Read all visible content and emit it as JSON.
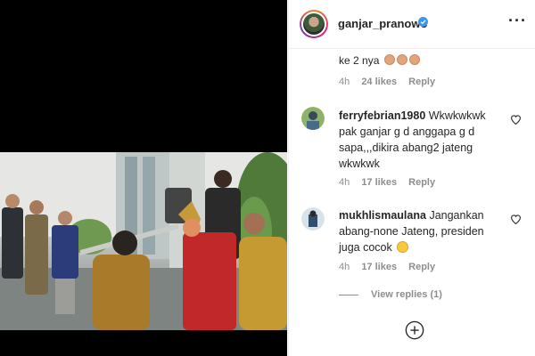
{
  "post": {
    "username": "ganjar_pranowo",
    "verified": true,
    "menu_icon": "more-icon"
  },
  "comments": [
    {
      "username": "",
      "text": "ke 2 nya",
      "emojis": [
        "clapping-hands",
        "clapping-hands",
        "clapping-hands"
      ],
      "time": "4h",
      "likes": "24 likes",
      "reply": "Reply"
    },
    {
      "username": "ferryfebrian1980",
      "text": "Wkwkwkwk pak ganjar g d anggapa g d sapa,,,dikira abang2 jateng wkwkwk",
      "time": "4h",
      "likes": "17 likes",
      "reply": "Reply"
    },
    {
      "username": "mukhlismaulana",
      "text": "Jangankan abang-none Jateng, presiden juga cocok",
      "emojis": [
        "grinning-face"
      ],
      "time": "4h",
      "likes": "17 likes",
      "reply": "Reply"
    }
  ],
  "view_replies": "View replies (1)",
  "colors": {
    "text": "#262626",
    "muted": "#8e8e8e",
    "verified": "#3897f0",
    "border": "#efefef"
  }
}
